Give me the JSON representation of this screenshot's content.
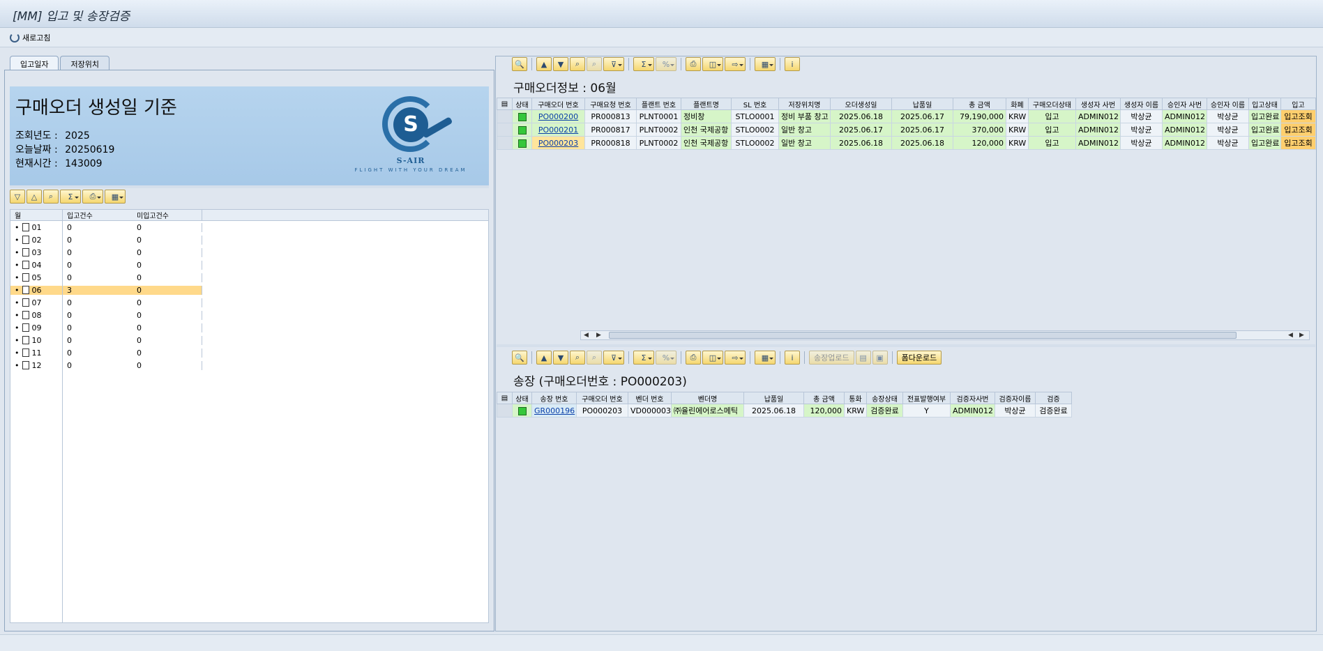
{
  "window": {
    "title": "[MM] 입고 및 송장검증"
  },
  "appbar": {
    "refresh_label": "새로고침"
  },
  "left": {
    "tabs": [
      {
        "label": "입고일자"
      },
      {
        "label": "저장위치"
      }
    ],
    "banner": {
      "heading": "구매오더 생성일 기준",
      "year_label": "조회년도 :",
      "year_value": "2025",
      "today_label": "오늘날짜 :",
      "today_value": "20250619",
      "time_label": "현재시간 :",
      "time_value": "143009",
      "logo_name": "S-AIR",
      "logo_slogan": "FLIGHT WITH YOUR DREAM"
    },
    "tree": {
      "headers": {
        "month": "월",
        "received": "입고건수",
        "not_received": "미입고건수"
      },
      "rows": [
        {
          "month": "01",
          "received": "0",
          "not_received": "0"
        },
        {
          "month": "02",
          "received": "0",
          "not_received": "0"
        },
        {
          "month": "03",
          "received": "0",
          "not_received": "0"
        },
        {
          "month": "04",
          "received": "0",
          "not_received": "0"
        },
        {
          "month": "05",
          "received": "0",
          "not_received": "0"
        },
        {
          "month": "06",
          "received": "3",
          "not_received": "0"
        },
        {
          "month": "07",
          "received": "0",
          "not_received": "0"
        },
        {
          "month": "08",
          "received": "0",
          "not_received": "0"
        },
        {
          "month": "09",
          "received": "0",
          "not_received": "0"
        },
        {
          "month": "10",
          "received": "0",
          "not_received": "0"
        },
        {
          "month": "11",
          "received": "0",
          "not_received": "0"
        },
        {
          "month": "12",
          "received": "0",
          "not_received": "0"
        }
      ]
    }
  },
  "po": {
    "title": "구매오더정보 : 06월",
    "headers": [
      "상태",
      "구매오더 번호",
      "구매요청 번호",
      "플랜트 번호",
      "플랜트명",
      "SL 번호",
      "저장위치명",
      "오더생성일",
      "납품일",
      "총 금액",
      "화폐",
      "구매오더상태",
      "생성자 사번",
      "생성자 이름",
      "승인자 사번",
      "승인자 이름",
      "입고상태",
      "입고"
    ],
    "rows": [
      {
        "po": "PO000200",
        "pr": "PR000813",
        "plant": "PLNT0001",
        "plant_name": "정비창",
        "sl": "STLO0001",
        "sl_name": "정비 부품 창고",
        "created": "2025.06.18",
        "delivery": "2025.06.17",
        "amount": "79,190,000",
        "currency": "KRW",
        "po_status": "입고",
        "creator_id": "ADMIN012",
        "creator_name": "박상균",
        "approver_id": "ADMIN012",
        "approver_name": "박상균",
        "gr_status": "입고완료",
        "gr": "입고조회"
      },
      {
        "po": "PO000201",
        "pr": "PR000817",
        "plant": "PLNT0002",
        "plant_name": "인천 국제공항",
        "sl": "STLO0002",
        "sl_name": "일반 창고",
        "created": "2025.06.17",
        "delivery": "2025.06.17",
        "amount": "370,000",
        "currency": "KRW",
        "po_status": "입고",
        "creator_id": "ADMIN012",
        "creator_name": "박상균",
        "approver_id": "ADMIN012",
        "approver_name": "박상균",
        "gr_status": "입고완료",
        "gr": "입고조회"
      },
      {
        "po": "PO000203",
        "pr": "PR000818",
        "plant": "PLNT0002",
        "plant_name": "인천 국제공항",
        "sl": "STLO0002",
        "sl_name": "일반 창고",
        "created": "2025.06.18",
        "delivery": "2025.06.18",
        "amount": "120,000",
        "currency": "KRW",
        "po_status": "입고",
        "creator_id": "ADMIN012",
        "creator_name": "박상균",
        "approver_id": "ADMIN012",
        "approver_name": "박상균",
        "gr_status": "입고완료",
        "gr": "입고조회"
      }
    ]
  },
  "invoice": {
    "title": "송장 (구매오더번호 : PO000203)",
    "upload_label": "송장업로드",
    "download_label": "폼다운로드",
    "headers": [
      "상태",
      "송장 번호",
      "구매오더 번호",
      "벤더 번호",
      "벤더명",
      "납품일",
      "총 금액",
      "통화",
      "송장상태",
      "전표발행여부",
      "검증자사번",
      "검증자이름",
      "검증"
    ],
    "rows": [
      {
        "invoice": "GR000196",
        "po": "PO000203",
        "vendor": "VD000003",
        "vendor_name": "㈜율린에어로스메틱",
        "delivery": "2025.06.18",
        "amount": "120,000",
        "currency": "KRW",
        "inv_status": "검증완료",
        "posted": "Y",
        "verifier_id": "ADMIN012",
        "verifier_name": "박상균",
        "verify": "검증완료"
      }
    ]
  },
  "colors": {
    "status_green": "#35c73a",
    "link_blue": "#0a3fa8",
    "selection": "#ffd98a"
  }
}
